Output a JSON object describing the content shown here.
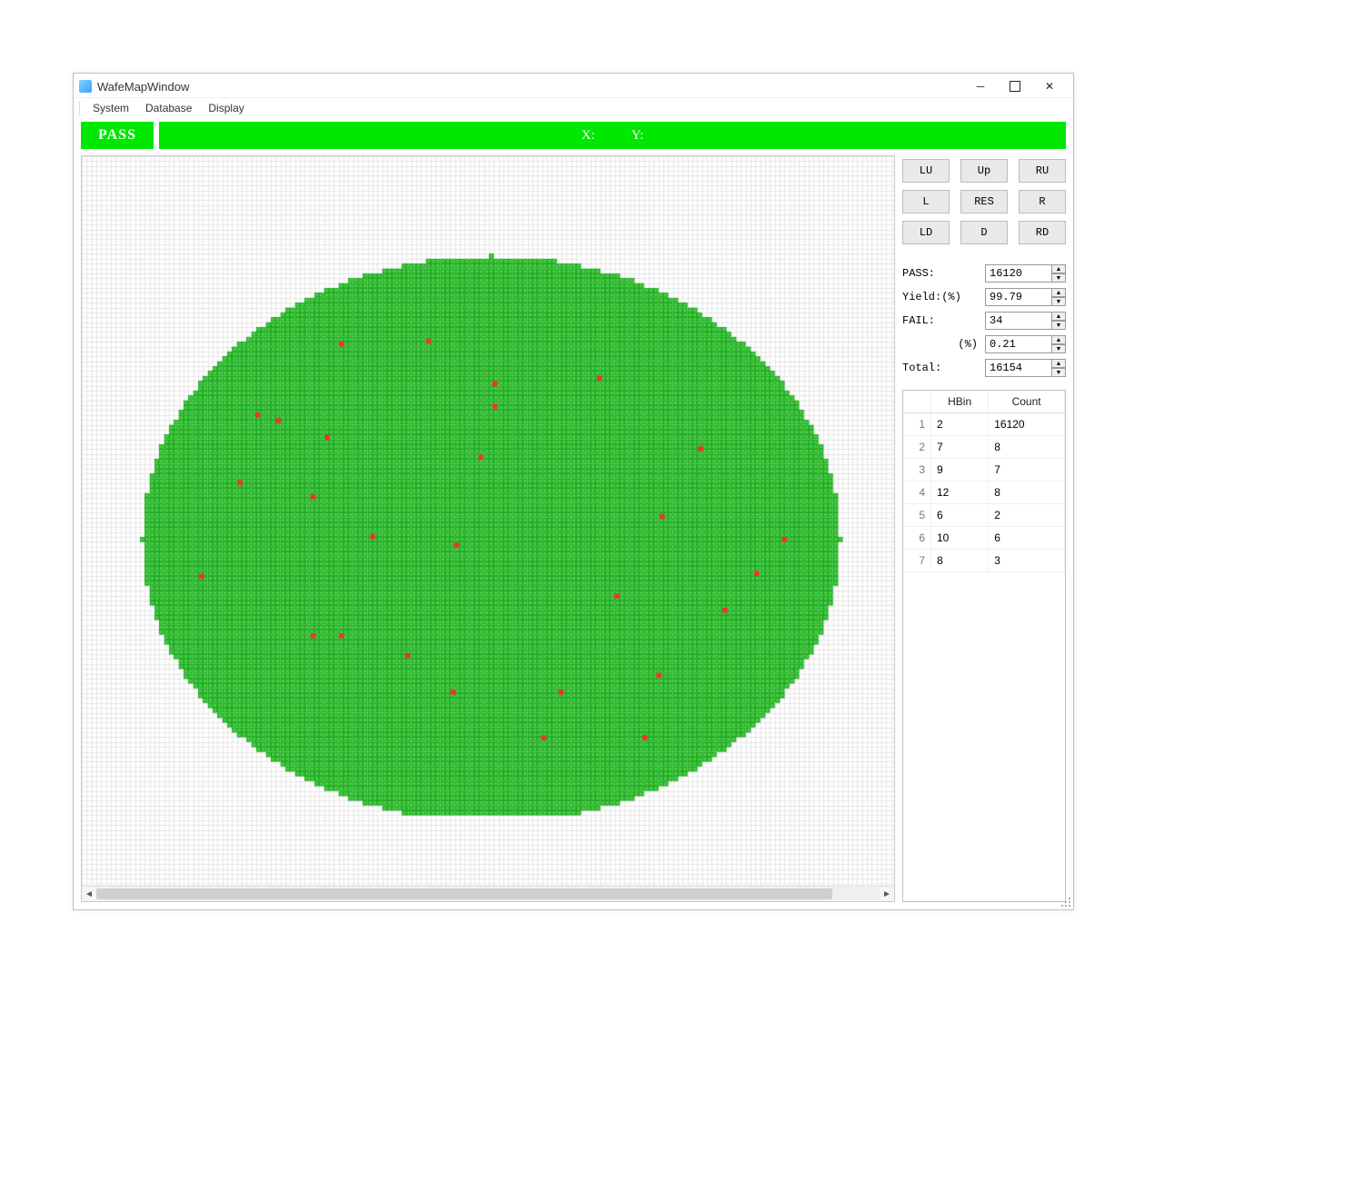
{
  "window": {
    "title": "WafeMapWindow"
  },
  "menu": {
    "items": [
      "System",
      "Database",
      "Display"
    ]
  },
  "status": {
    "badge": "PASS",
    "x_label": "X:",
    "y_label": "Y:"
  },
  "dirpad": {
    "LU": "LU",
    "Up": "Up",
    "RU": "RU",
    "L": "L",
    "RES": "RES",
    "R": "R",
    "LD": "LD",
    "D": "D",
    "RD": "RD"
  },
  "stats": {
    "pass_label": "PASS:",
    "pass": "16120",
    "yield_label": "Yield:(%)",
    "yield": "99.79",
    "fail_label": "FAIL:",
    "fail": "34",
    "failpct_label": "(%)",
    "failpct": "0.21",
    "total_label": "Total:",
    "total": "16154"
  },
  "bin_table": {
    "columns": [
      "",
      "HBin",
      "Count"
    ],
    "rows": [
      {
        "idx": "1",
        "hbin": "2",
        "count": "16120"
      },
      {
        "idx": "2",
        "hbin": "7",
        "count": "8"
      },
      {
        "idx": "3",
        "hbin": "9",
        "count": "7"
      },
      {
        "idx": "4",
        "hbin": "12",
        "count": "8"
      },
      {
        "idx": "5",
        "hbin": "6",
        "count": "2"
      },
      {
        "idx": "6",
        "hbin": "10",
        "count": "6"
      },
      {
        "idx": "7",
        "hbin": "8",
        "count": "3"
      }
    ]
  },
  "chart_data": {
    "type": "heatmap",
    "title": "Wafer Map",
    "pass_color": "#3fd23f",
    "fail_color": "#ff2a2a",
    "grid_color": "#e6e6e6",
    "pass_count": 16120,
    "fail_count": 34,
    "total": 16154,
    "grid_cols": 168,
    "grid_rows": 150,
    "ellipse_cx_col": 84,
    "ellipse_cy_row": 78,
    "ellipse_rx_cols": 72,
    "ellipse_ry_rows": 58,
    "flat_bottom": true,
    "fail_points_fraction": [
      [
        0.285,
        0.155
      ],
      [
        0.41,
        0.15
      ],
      [
        0.165,
        0.28
      ],
      [
        0.195,
        0.29
      ],
      [
        0.265,
        0.32
      ],
      [
        0.505,
        0.265
      ],
      [
        0.245,
        0.425
      ],
      [
        0.485,
        0.355
      ],
      [
        0.085,
        0.565
      ],
      [
        0.245,
        0.67
      ],
      [
        0.285,
        0.67
      ],
      [
        0.445,
        0.77
      ],
      [
        0.745,
        0.46
      ],
      [
        0.835,
        0.625
      ],
      [
        0.68,
        0.6
      ],
      [
        0.72,
        0.85
      ],
      [
        0.575,
        0.85
      ],
      [
        0.505,
        0.225
      ],
      [
        0.88,
        0.56
      ],
      [
        0.14,
        0.4
      ],
      [
        0.92,
        0.5
      ],
      [
        0.38,
        0.705
      ],
      [
        0.655,
        0.215
      ],
      [
        0.8,
        0.34
      ],
      [
        0.45,
        0.51
      ],
      [
        0.6,
        0.77
      ],
      [
        0.33,
        0.495
      ],
      [
        0.74,
        0.74
      ]
    ]
  }
}
